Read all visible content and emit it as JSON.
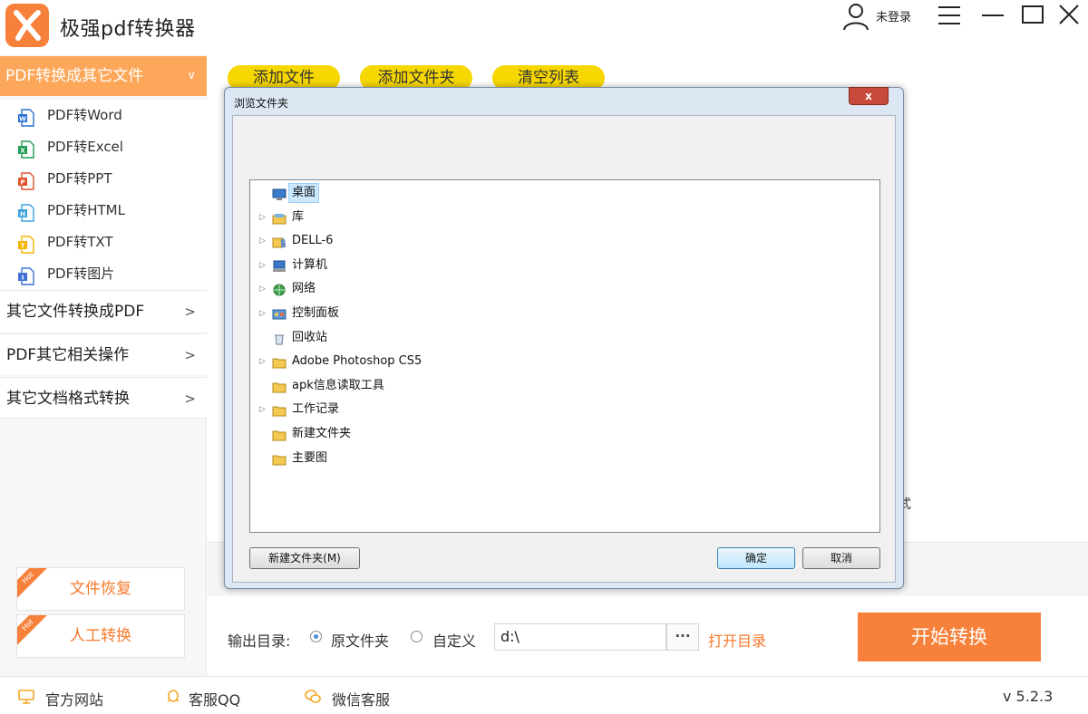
{
  "app": {
    "title": "极强pdf转换器",
    "login": "未登录",
    "version": "v 5.2.3"
  },
  "sidebar": {
    "active_category": "PDF转换成其它文件",
    "sub_items": [
      {
        "label": "PDF转Word",
        "icon": "word-file-icon",
        "color": "#2b6fd6",
        "letter": "W"
      },
      {
        "label": "PDF转Excel",
        "icon": "excel-file-icon",
        "color": "#1f9d55",
        "letter": "X"
      },
      {
        "label": "PDF转PPT",
        "icon": "ppt-file-icon",
        "color": "#e0522e",
        "letter": "P"
      },
      {
        "label": "PDF转HTML",
        "icon": "html-file-icon",
        "color": "#3aa3e0",
        "letter": "H"
      },
      {
        "label": "PDF转TXT",
        "icon": "txt-file-icon",
        "color": "#f2b400",
        "letter": "T"
      },
      {
        "label": "PDF转图片",
        "icon": "image-file-icon",
        "color": "#3f6fd8",
        "letter": "I"
      }
    ],
    "categories": [
      "其它文件转换成PDF",
      "PDF其它相关操作",
      "其它文档格式转换"
    ],
    "hot_buttons": [
      {
        "label": "文件恢复",
        "tag": "Hot"
      },
      {
        "label": "人工转换",
        "tag": "Hot"
      }
    ]
  },
  "toolbar": {
    "add_file": "添加文件",
    "add_folder": "添加文件夹",
    "clear_list": "清空列表"
  },
  "main": {
    "stray_char": "式"
  },
  "output": {
    "label": "输出目录:",
    "option_source": "原文件夹",
    "option_custom": "自定义",
    "path": "d:\\",
    "browse": "···",
    "open_dir": "打开目录",
    "start": "开始转换"
  },
  "footer": {
    "website": "官方网站",
    "qq": "客服QQ",
    "wechat": "微信客服"
  },
  "dialog": {
    "title": "浏览文件夹",
    "close": "x",
    "tree": [
      {
        "label": "桌面",
        "icon": "desktop-icon",
        "arrow": "",
        "selected": true
      },
      {
        "label": "库",
        "icon": "library-icon",
        "arrow": "▷"
      },
      {
        "label": "DELL-6",
        "icon": "user-folder-icon",
        "arrow": "▷"
      },
      {
        "label": "计算机",
        "icon": "computer-icon",
        "arrow": "▷"
      },
      {
        "label": "网络",
        "icon": "network-icon",
        "arrow": "▷"
      },
      {
        "label": "控制面板",
        "icon": "control-panel-icon",
        "arrow": "▷"
      },
      {
        "label": "回收站",
        "icon": "recycle-bin-icon",
        "arrow": ""
      },
      {
        "label": "Adobe Photoshop CS5",
        "icon": "folder-icon",
        "arrow": "▷"
      },
      {
        "label": "apk信息读取工具",
        "icon": "folder-icon",
        "arrow": ""
      },
      {
        "label": "工作记录",
        "icon": "folder-icon",
        "arrow": "▷"
      },
      {
        "label": "新建文件夹",
        "icon": "folder-icon",
        "arrow": ""
      },
      {
        "label": "主要图",
        "icon": "folder-icon",
        "arrow": ""
      }
    ],
    "new_folder": "新建文件夹(M)",
    "ok": "确定",
    "cancel": "取消"
  }
}
